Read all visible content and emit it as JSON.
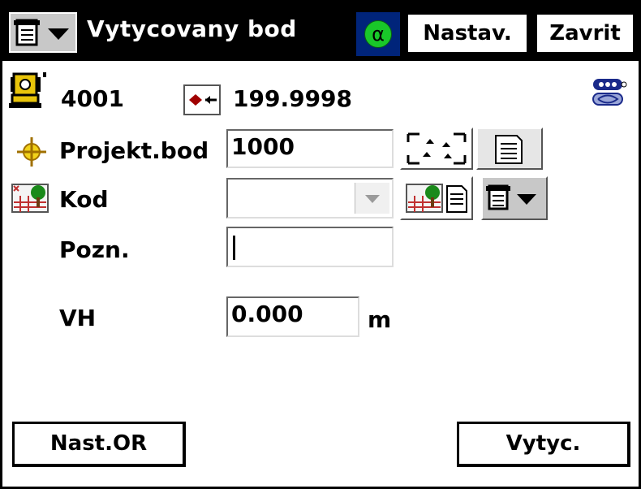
{
  "window": {
    "title": "Vytycovany bod",
    "settings_label": "Nastav.",
    "close_label": "Zavrit",
    "mode_symbol": "α"
  },
  "info": {
    "station_id": "4001",
    "backsight_value": "199.9998"
  },
  "form": {
    "point_label": "Projekt.bod",
    "point_value": "1000",
    "code_label": "Kod",
    "code_value": "",
    "note_label": "Pozn.",
    "note_value": "",
    "height_label": "VH",
    "height_value": "0.000",
    "height_unit": "m"
  },
  "footer": {
    "orientation_label": "Nast.OR",
    "stakeout_label": "Vytyc."
  },
  "icons": {
    "menu": "menu-list-icon",
    "instrument": "total-station-icon",
    "backsight": "backsight-icon",
    "connection": "connection-icon",
    "target": "crosshair-icon",
    "code": "code-map-icon"
  },
  "colors": {
    "titlebar": "#000000",
    "alpha_bg": "#00247a",
    "alpha_circle": "#19c829",
    "button_face": "#e6e6e6"
  }
}
